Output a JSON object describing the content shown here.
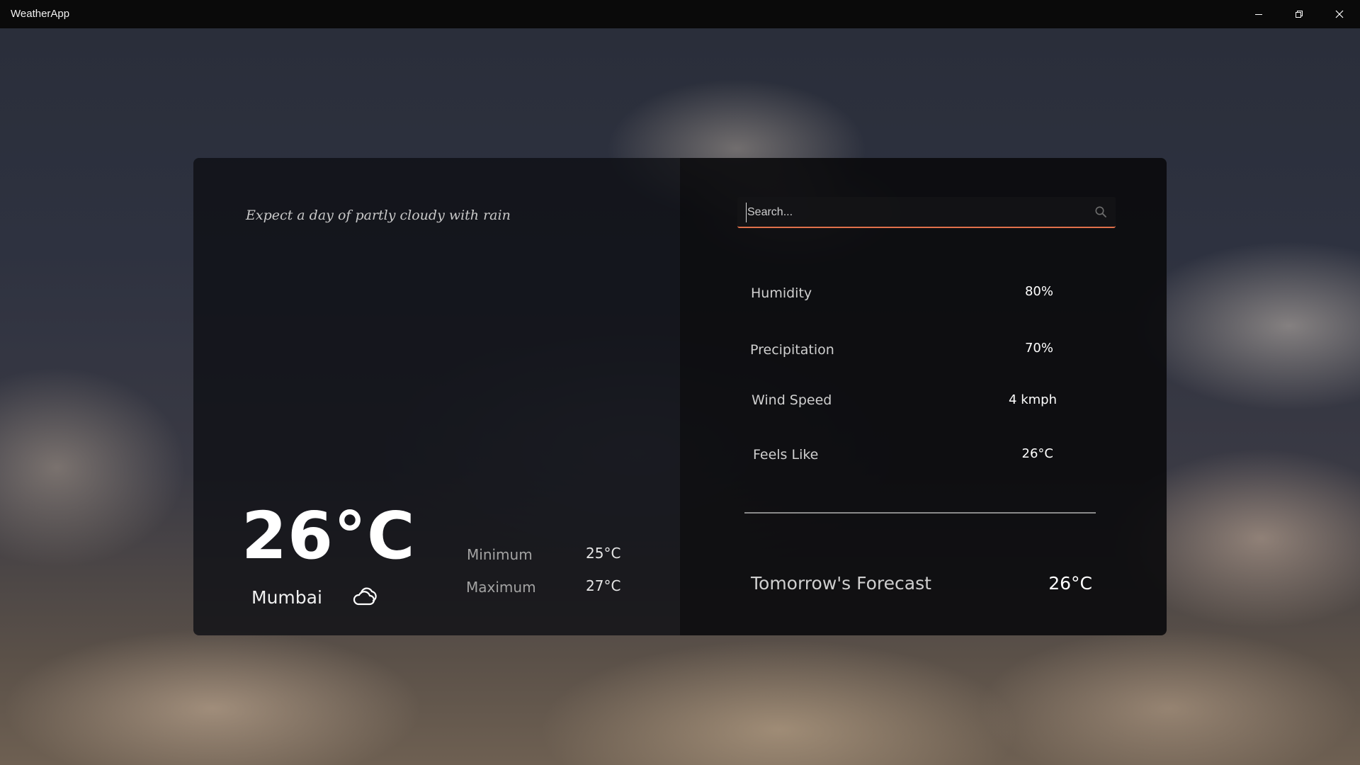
{
  "window": {
    "title": "WeatherApp",
    "minimize_icon": "minimize-icon",
    "restore_icon": "restore-icon",
    "close_icon": "close-icon"
  },
  "current": {
    "summary": "Expect a day of partly cloudy with rain",
    "temperature": "26°C",
    "city": "Mumbai",
    "icon": "partly-cloudy-icon",
    "minimum_label": "Minimum",
    "minimum_value": "25°C",
    "maximum_label": "Maximum",
    "maximum_value": "27°C"
  },
  "search": {
    "placeholder": "Search...",
    "value": "",
    "icon": "search-icon"
  },
  "stats": [
    {
      "label": "Humidity",
      "value": "80%"
    },
    {
      "label": "Precipitation",
      "value": "70%"
    },
    {
      "label": "Wind Speed",
      "value": "4 kmph"
    },
    {
      "label": "Feels Like",
      "value": "26°C"
    }
  ],
  "forecast": {
    "label": "Tomorrow's Forecast",
    "value": "26°C"
  },
  "colors": {
    "search_underline": "#e0704a",
    "title_bar": "#0a0a0a"
  }
}
